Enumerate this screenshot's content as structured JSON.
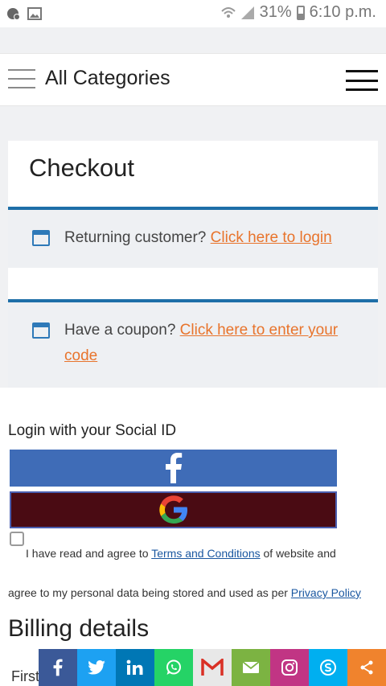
{
  "status_bar": {
    "battery": "31%",
    "time": "6:10 p.m."
  },
  "header": {
    "title": "All Categories"
  },
  "checkout": {
    "title": "Checkout",
    "returning_text": "Returning customer?",
    "returning_link": "Click here to login",
    "coupon_text": "Have a coupon?",
    "coupon_link": "Click here to enter your code"
  },
  "social": {
    "label": "Login with your Social ID"
  },
  "terms": {
    "line1_prefix": "I have read and agree to",
    "terms_link": "Terms and Conditions",
    "line1_suffix": "of website and",
    "line2_prefix": "agree to my personal data being stored and used as per",
    "privacy_link": "Privacy Policy"
  },
  "billing": {
    "title": "Billing details",
    "first_label": "First"
  },
  "share_bar": {
    "items": [
      {
        "icon": "facebook-icon",
        "color": "#3b5998"
      },
      {
        "icon": "twitter-icon",
        "color": "#1da1f2"
      },
      {
        "icon": "linkedin-icon",
        "color": "#0077b5"
      },
      {
        "icon": "whatsapp-icon",
        "color": "#25d366"
      },
      {
        "icon": "gmail-icon",
        "color": "#e8e8e8"
      },
      {
        "icon": "email-icon",
        "color": "#7cb342"
      },
      {
        "icon": "instagram-icon",
        "color": "#c13584"
      },
      {
        "icon": "skype-icon",
        "color": "#00aff0"
      },
      {
        "icon": "share-icon",
        "color": "#f0832d"
      }
    ]
  }
}
